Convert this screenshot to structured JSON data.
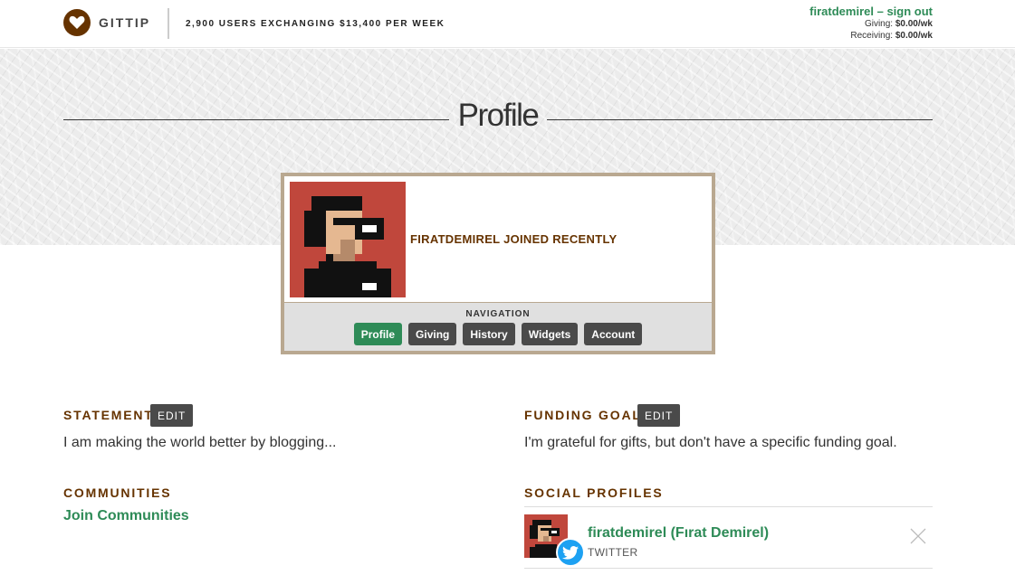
{
  "header": {
    "logo_text": "GITTIP",
    "tagline": "2,900 USERS EXCHANGING $13,400 PER WEEK",
    "username": "firatdemirel",
    "dash": " – ",
    "sign_out": "sign out",
    "giving_label": "Giving: ",
    "giving_value": "$0.00/wk",
    "receiving_label": "Receiving: ",
    "receiving_value": "$0.00/wk"
  },
  "page": {
    "title": "Profile"
  },
  "card": {
    "joined_text": "FIRATDEMIREL JOINED RECENTLY",
    "nav_label": "NAVIGATION",
    "nav_items": [
      "Profile",
      "Giving",
      "History",
      "Widgets",
      "Account"
    ],
    "active_index": 0
  },
  "statement": {
    "heading": "STATEMENT",
    "edit_label": "EDIT",
    "text": "I am making the world better by blogging..."
  },
  "communities": {
    "heading": "COMMUNITIES",
    "link": "Join Communities"
  },
  "funding_goal": {
    "heading": "FUNDING GOAL",
    "edit_label": "EDIT",
    "text": "I'm grateful for gifts, but don't have a specific funding goal."
  },
  "social_profiles": {
    "heading": "SOCIAL PROFILES",
    "items": [
      {
        "name": "firatdemirel (Fırat Demirel)",
        "platform": "TWITTER",
        "icon": "twitter-icon"
      }
    ]
  },
  "colors": {
    "brand_brown": "#663300",
    "accent_green": "#2e8b57",
    "button_dark": "#4a4a4a",
    "card_border": "#b9a890",
    "twitter_blue": "#1da1f2"
  }
}
